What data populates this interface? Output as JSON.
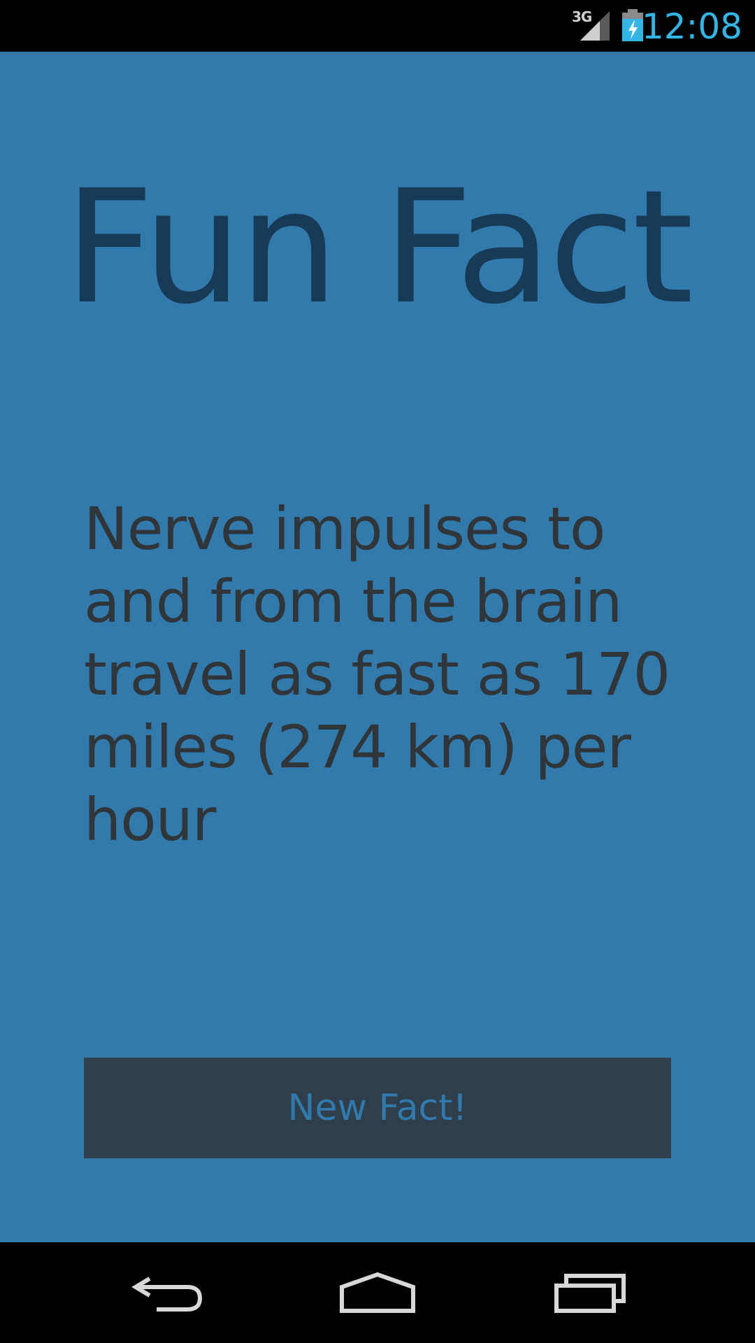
{
  "status_bar": {
    "network": "3G",
    "time": "12:08",
    "icons": [
      "signal-icon",
      "battery-charging-icon"
    ]
  },
  "main": {
    "title": "Fun Fact",
    "fact_text": "Nerve impulses to and from the brain travel as fast as 170 miles (274 km) per hour",
    "button_label": "New Fact!"
  },
  "nav_bar": {
    "icons": [
      "back-icon",
      "home-icon",
      "recents-icon"
    ]
  },
  "colors": {
    "background": "#3279ac",
    "title": "#173b56",
    "fact_text": "#2f3538",
    "button_bg": "#2e3e4b",
    "button_text": "#3279ac",
    "clock": "#33b5e5"
  }
}
